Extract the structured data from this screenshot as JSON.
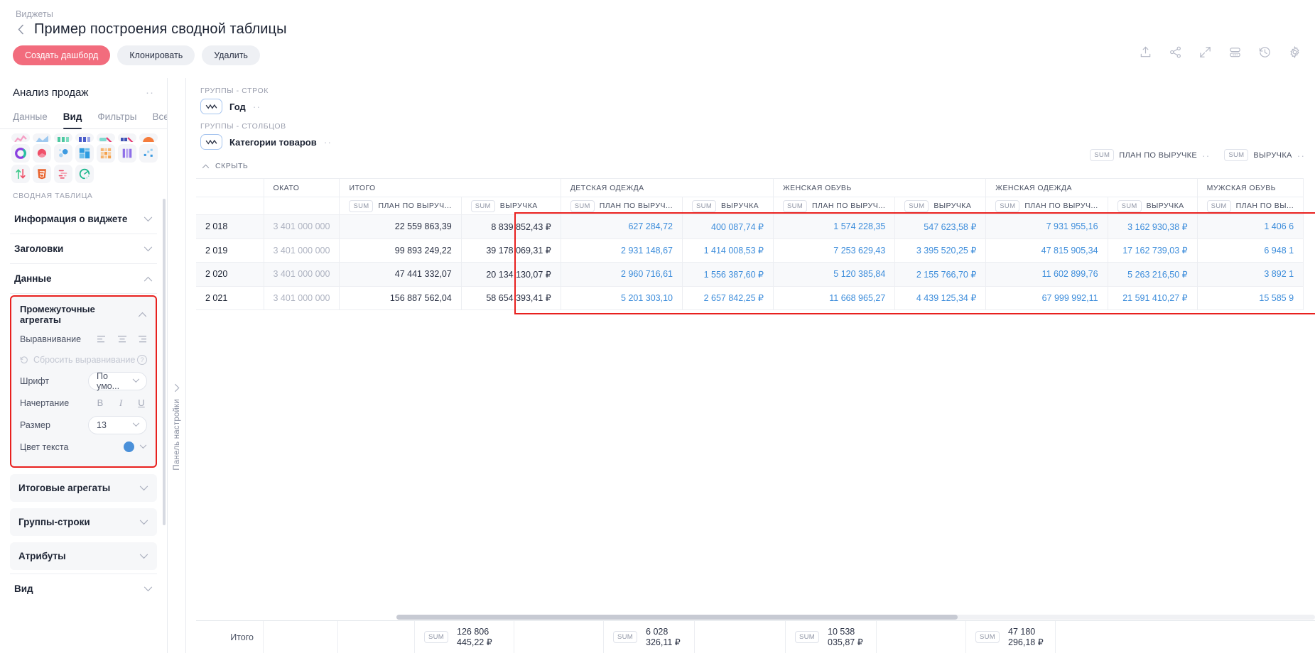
{
  "header": {
    "breadcrumb": "Виджеты",
    "title": "Пример построения сводной таблицы",
    "buttons": [
      {
        "label": "Создать дашборд",
        "style": "primary"
      },
      {
        "label": "Клонировать",
        "style": "ghost"
      },
      {
        "label": "Удалить",
        "style": "ghost"
      }
    ],
    "toolbar_icons": [
      "upload-icon",
      "share-icon",
      "fullscreen-icon",
      "layout-icon",
      "history-icon",
      "gear-icon"
    ]
  },
  "left_panel": {
    "title": "Анализ продаж",
    "tabs": [
      {
        "label": "Данные",
        "active": false
      },
      {
        "label": "Вид",
        "active": true
      },
      {
        "label": "Фильтры",
        "active": false
      },
      {
        "label": "Все",
        "active": false
      }
    ],
    "section_label": "СВОДНАЯ ТАБЛИЦА",
    "accordions": [
      {
        "label": "Информация о виджете",
        "state": "collapsed"
      },
      {
        "label": "Заголовки",
        "state": "collapsed"
      },
      {
        "label": "Данные",
        "state": "expanded"
      }
    ],
    "subpanel": {
      "title": "Промежуточные агрегаты",
      "alignment_label": "Выравнивание",
      "reset_label": "Сбросить выравнивание",
      "font_label": "Шрифт",
      "font_value": "По умо...",
      "style_label": "Начертание",
      "style_buttons": [
        "B",
        "I",
        "U"
      ],
      "size_label": "Размер",
      "size_value": "13",
      "color_label": "Цвет текста",
      "color_value": "#4a90d9",
      "highlight_color": "#e8201e"
    },
    "cards": [
      {
        "label": "Итоговые агрегаты"
      },
      {
        "label": "Группы-строки"
      },
      {
        "label": "Атрибуты"
      }
    ],
    "bottom_accordion": {
      "label": "Вид"
    },
    "collapse_strip_label": "Панель настройки"
  },
  "groups": {
    "rows_label": "ГРУППЫ - СТРОК",
    "rows_chip": "Год",
    "cols_label": "ГРУППЫ - СТОЛБЦОВ",
    "cols_chip": "Категории товаров"
  },
  "measures": [
    {
      "agg": "SUM",
      "name": "ПЛАН ПО ВЫРУЧКЕ"
    },
    {
      "agg": "SUM",
      "name": "ВЫРУЧКА"
    }
  ],
  "hide_control": {
    "label": "СКРЫТЬ"
  },
  "table": {
    "col_groups": [
      {
        "label": "",
        "span": 1
      },
      {
        "label": "ОКАТО",
        "span": 1
      },
      {
        "label": "ИТОГО",
        "span": 2
      },
      {
        "label": "ДЕТСКАЯ ОДЕЖДА",
        "span": 2
      },
      {
        "label": "ЖЕНСКАЯ ОБУВЬ",
        "span": 2
      },
      {
        "label": "ЖЕНСКАЯ ОДЕЖДА",
        "span": 2
      },
      {
        "label": "МУЖСКАЯ ОБУВЬ",
        "span": 2
      }
    ],
    "sub_headers": [
      {
        "agg": "",
        "label": ""
      },
      {
        "agg": "",
        "label": ""
      },
      {
        "agg": "SUM",
        "label": "ПЛАН ПО ВЫРУЧ..."
      },
      {
        "agg": "SUM",
        "label": "ВЫРУЧКА"
      },
      {
        "agg": "SUM",
        "label": "ПЛАН ПО ВЫРУЧ..."
      },
      {
        "agg": "SUM",
        "label": "ВЫРУЧКА"
      },
      {
        "agg": "SUM",
        "label": "ПЛАН ПО ВЫРУЧ..."
      },
      {
        "agg": "SUM",
        "label": "ВЫРУЧКА"
      },
      {
        "agg": "SUM",
        "label": "ПЛАН ПО ВЫРУЧ..."
      },
      {
        "agg": "SUM",
        "label": "ВЫРУЧКА"
      },
      {
        "agg": "SUM",
        "label": "ПЛАН ПО ВЫ..."
      }
    ],
    "rows": [
      {
        "year": "2 018",
        "okato": "3 401 000 000",
        "cells": [
          "22 559 863,39",
          "8 839 852,43 ₽",
          "627 284,72",
          "400 087,74 ₽",
          "1 574 228,35",
          "547 623,58 ₽",
          "7 931 955,16",
          "3 162 930,38 ₽",
          "1 406 6"
        ]
      },
      {
        "year": "2 019",
        "okato": "3 401 000 000",
        "cells": [
          "99 893 249,22",
          "39 178 069,31 ₽",
          "2 931 148,67",
          "1 414 008,53 ₽",
          "7 253 629,43",
          "3 395 520,25 ₽",
          "47 815 905,34",
          "17 162 739,03 ₽",
          "6 948 1"
        ]
      },
      {
        "year": "2 020",
        "okato": "3 401 000 000",
        "cells": [
          "47 441 332,07",
          "20 134 130,07 ₽",
          "2 960 716,61",
          "1 556 387,60 ₽",
          "5 120 385,84",
          "2 155 766,70 ₽",
          "11 602 899,76",
          "5 263 216,50 ₽",
          "3 892 1"
        ]
      },
      {
        "year": "2 021",
        "okato": "3 401 000 000",
        "cells": [
          "156 887 562,04",
          "58 654 393,41 ₽",
          "5 201 303,10",
          "2 657 842,25 ₽",
          "11 668 965,27",
          "4 439 125,34 ₽",
          "67 999 992,11",
          "21 591 410,27 ₽",
          "15 585 9"
        ]
      }
    ]
  },
  "totals": {
    "label": "Итого",
    "cells": [
      {
        "agg": "SUM",
        "value": "126 806 445,22 ₽"
      },
      {
        "agg": "SUM",
        "value": "6 028 326,11 ₽"
      },
      {
        "agg": "SUM",
        "value": "10 538 035,87 ₽"
      },
      {
        "agg": "SUM",
        "value": "47 180 296,18 ₽"
      }
    ]
  },
  "colors": {
    "accent_primary": "#f26c7d",
    "data_blue": "#3d8ddb",
    "highlight_red": "#e8201e"
  }
}
